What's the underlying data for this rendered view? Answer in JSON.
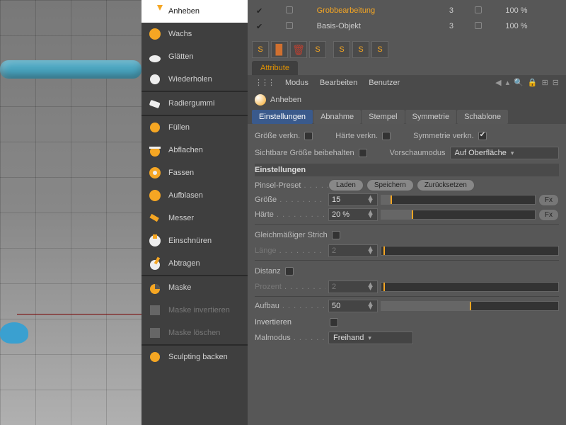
{
  "tools": {
    "group1": [
      "Anheben",
      "Wachs",
      "Glätten",
      "Wiederholen"
    ],
    "group2": [
      "Radiergummi"
    ],
    "group3": [
      "Füllen",
      "Abflachen",
      "Fassen",
      "Aufblasen",
      "Messer",
      "Einschnüren",
      "Abtragen"
    ],
    "group4": [
      "Maske",
      "Maske invertieren",
      "Maske löschen"
    ],
    "group5": [
      "Sculpting backen"
    ]
  },
  "layers": {
    "rows": [
      {
        "name": "Grobbearbeitung",
        "count": "3",
        "pct": "100 %",
        "active": true
      },
      {
        "name": "Basis-Objekt",
        "count": "3",
        "pct": "100 %",
        "active": false
      }
    ]
  },
  "attributeTab": "Attribute",
  "menu": {
    "modus": "Modus",
    "bearbeiten": "Bearbeiten",
    "benutzer": "Benutzer"
  },
  "currentTool": "Anheben",
  "tabs": [
    "Einstellungen",
    "Abnahme",
    "Stempel",
    "Symmetrie",
    "Schablone"
  ],
  "activeTabIdx": 0,
  "topChecks": {
    "groesse": "Größe verkn.",
    "haerte": "Härte verkn.",
    "symmetrie": "Symmetrie verkn.",
    "sichtbar": "Sichtbare Größe beibehalten",
    "vorschaumodus": "Vorschaumodus",
    "vorschaumodus_value": "Auf Oberfläche"
  },
  "settings": {
    "title": "Einstellungen",
    "preset_label": "Pinsel-Preset",
    "laden": "Laden",
    "speichern": "Speichern",
    "zurueck": "Zurücksetzen",
    "groesse": "Größe",
    "groesse_val": "15",
    "haerte": "Härte",
    "haerte_val": "20 %",
    "fx": "Fx",
    "gleich": "Gleichmäßiger Strich",
    "laenge": "Länge",
    "laenge_val": "2",
    "distanz": "Distanz",
    "prozent": "Prozent",
    "prozent_val": "2",
    "aufbau": "Aufbau",
    "aufbau_val": "50",
    "invert": "Invertieren",
    "malmodus": "Malmodus",
    "malmodus_val": "Freihand"
  }
}
